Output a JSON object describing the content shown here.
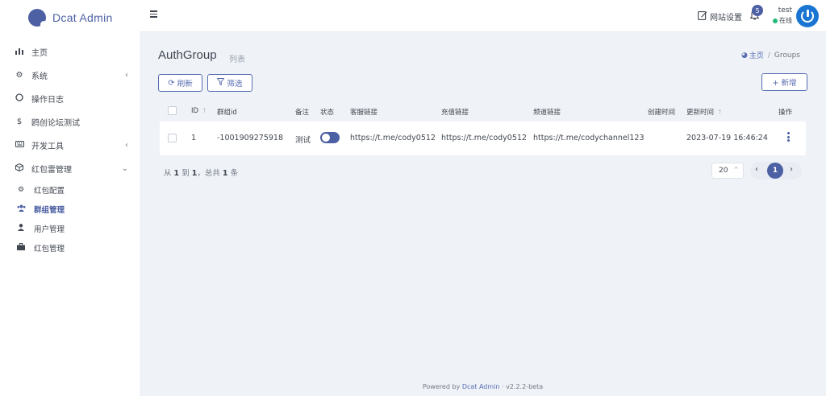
{
  "brand": {
    "name": "Dcat Admin"
  },
  "sidebar": {
    "items": [
      {
        "label": "主页",
        "icon": "bar-chart-icon"
      },
      {
        "label": "系统",
        "icon": "gear-icon"
      },
      {
        "label": "操作日志",
        "icon": "circle-icon"
      },
      {
        "label": "鸥创论坛测试",
        "icon": "coins-icon"
      },
      {
        "label": "开发工具",
        "icon": "keyboard-icon"
      },
      {
        "label": "红包雷管理",
        "icon": "cube-icon"
      }
    ],
    "subitems": [
      {
        "label": "红包配置",
        "icon": "gear-icon"
      },
      {
        "label": "群组管理",
        "icon": "users-icon"
      },
      {
        "label": "用户管理",
        "icon": "user-icon"
      },
      {
        "label": "红包管理",
        "icon": "briefcase-icon"
      }
    ]
  },
  "topbar": {
    "site_settings": "网站设置",
    "notifications": "5",
    "user_name": "test",
    "user_status": "在线"
  },
  "page": {
    "title": "AuthGroup",
    "subtitle": "列表",
    "breadcrumb_home": "主页",
    "breadcrumb_current": "Groups"
  },
  "toolbar": {
    "refresh": "刷新",
    "filter": "筛选",
    "create": "+ 新增"
  },
  "table": {
    "headers": {
      "id": "ID",
      "group_id": "群组id",
      "remark": "备注",
      "status": "状态",
      "service_link": "客服链接",
      "recharge_link": "充值链接",
      "channel_link": "频道链接",
      "created_at": "创建时间",
      "updated_at": "更新时间",
      "actions": "操作"
    },
    "rows": [
      {
        "id": "1",
        "group_id": "-1001909275918",
        "remark": "测试",
        "status_on": true,
        "service_link": "https://t.me/cody0512",
        "recharge_link": "https://t.me/cody0512",
        "channel_link": "https://t.me/codychannel123",
        "created_at": "",
        "updated_at": "2023-07-19 16:46:24"
      }
    ]
  },
  "pagination": {
    "summary_prefix": "从",
    "from": "1",
    "to_word": "到",
    "to": "1",
    "total_prefix": "，总共",
    "total": "1",
    "total_suffix": "条",
    "per_page": "20",
    "current_page": "1"
  },
  "footer": {
    "powered_by": "Powered by",
    "brand_link": "Dcat Admin",
    "version": "· v2.2.2-beta"
  },
  "colors": {
    "primary": "#4c60a3",
    "online": "#21b978",
    "avatar": "#1a75d2"
  }
}
